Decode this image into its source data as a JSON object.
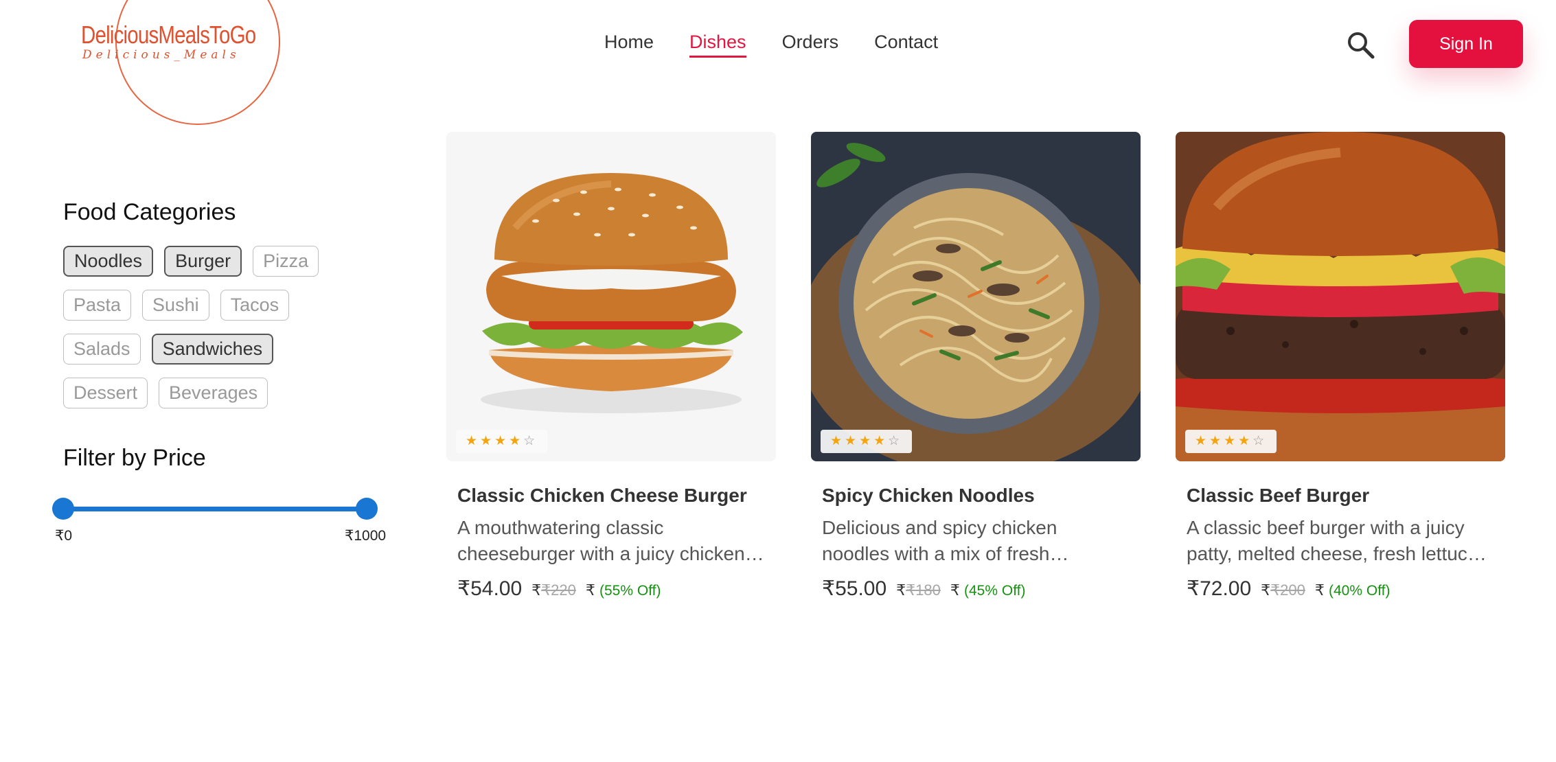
{
  "brand": {
    "name": "DeliciousMealsToGo",
    "tagline": "Delicious_Meals",
    "accent_color": "#e4103d",
    "logo_color": "#e0522f"
  },
  "nav": {
    "items": [
      "Home",
      "Dishes",
      "Orders",
      "Contact"
    ],
    "active": "Dishes"
  },
  "header": {
    "search_icon": "search-icon",
    "signin_label": "Sign In"
  },
  "sidebar": {
    "categories_title": "Food Categories",
    "categories": [
      {
        "label": "Noodles",
        "selected": true
      },
      {
        "label": "Burger",
        "selected": true
      },
      {
        "label": "Pizza",
        "selected": false
      },
      {
        "label": "Pasta",
        "selected": false
      },
      {
        "label": "Sushi",
        "selected": false
      },
      {
        "label": "Tacos",
        "selected": false
      },
      {
        "label": "Salads",
        "selected": false
      },
      {
        "label": "Sandwiches",
        "selected": true
      },
      {
        "label": "Dessert",
        "selected": false
      },
      {
        "label": "Beverages",
        "selected": false
      }
    ],
    "price_title": "Filter by Price",
    "price_min_label": "₹0",
    "price_max_label": "₹1000",
    "price_range": [
      0,
      1000
    ],
    "slider_color": "#1976d2"
  },
  "dishes": [
    {
      "title": "Classic Chicken Cheese Burger",
      "description": "A mouthwatering classic cheeseburger with a juicy chicken patty, melted cheese, and fresh veggies",
      "price": "₹54.00",
      "currency_symbol": "₹",
      "original_price": "₹220",
      "discount": "(55% Off)",
      "rating": 4,
      "image": "chicken-burger"
    },
    {
      "title": "Spicy Chicken Noodles",
      "description": "Delicious and spicy chicken noodles with a mix of fresh vegetables",
      "price": "₹55.00",
      "currency_symbol": "₹",
      "original_price": "₹180",
      "discount": "(45% Off)",
      "rating": 4,
      "image": "chicken-noodles"
    },
    {
      "title": "Classic Beef Burger",
      "description": "A classic beef burger with a juicy patty, melted cheese, fresh lettuce and tomato",
      "price": "₹72.00",
      "currency_symbol": "₹",
      "original_price": "₹200",
      "discount": "(40% Off)",
      "rating": 4,
      "image": "beef-burger"
    }
  ]
}
